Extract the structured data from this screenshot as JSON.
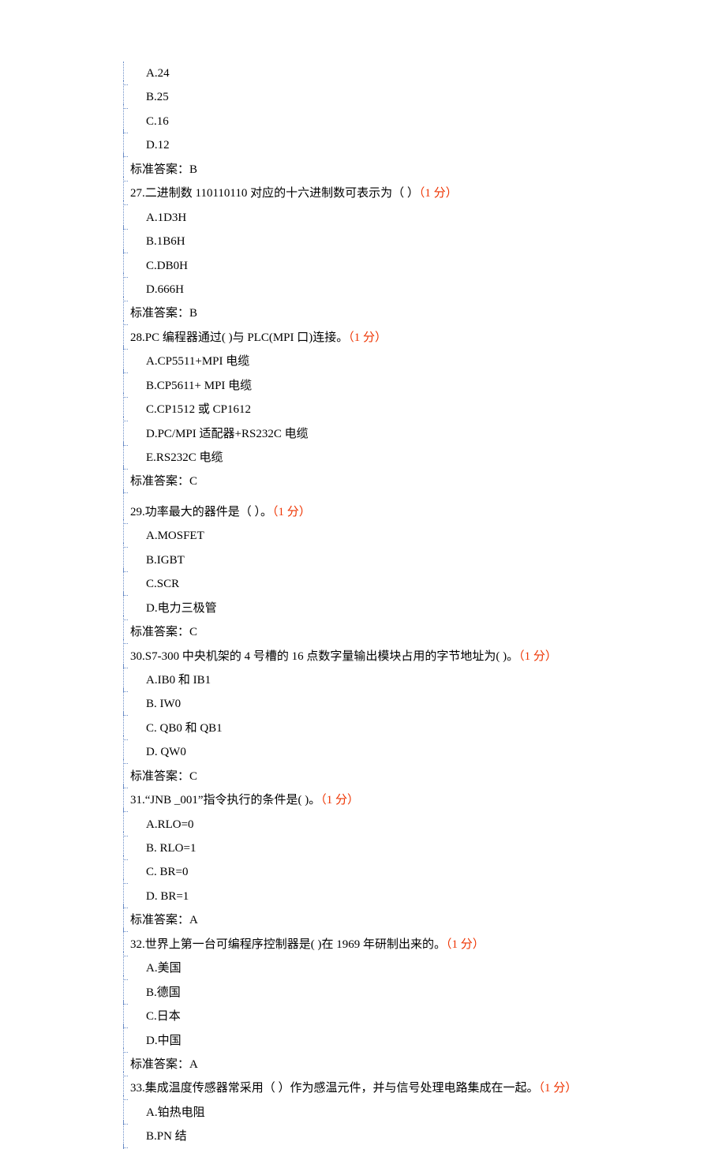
{
  "answer_prefix": "标准答案：",
  "points_label": "（1 分）",
  "orphan_options": [
    {
      "label": "A.24"
    },
    {
      "label": "B.25"
    },
    {
      "label": "C.16"
    },
    {
      "label": "D.12"
    }
  ],
  "orphan_answer": "B",
  "questions": [
    {
      "num": "27",
      "stem": "27.二进制数 110110110 对应的十六进制数可表示为（  ）",
      "options": [
        "A.1D3H",
        "B.1B6H",
        "C.DB0H",
        "D.666H"
      ],
      "answer": "B"
    },
    {
      "num": "28",
      "stem": "28.PC 编程器通过( )与 PLC(MPI 口)连接。",
      "options": [
        "A.CP5511+MPI 电缆",
        "B.CP5611+ MPI 电缆",
        "C.CP1512 或 CP1612",
        "D.PC/MPI 适配器+RS232C 电缆",
        "E.RS232C 电缆"
      ],
      "answer": "C"
    },
    {
      "num": "29",
      "stem": "29.功率最大的器件是（  ）。",
      "options": [
        "A.MOSFET",
        "B.IGBT",
        "C.SCR",
        "D.电力三极管"
      ],
      "answer": "C",
      "gap_before": true
    },
    {
      "num": "30",
      "stem": "30.S7-300 中央机架的 4 号槽的 16 点数字量输出模块占用的字节地址为( )。",
      "options": [
        "A.IB0 和 IB1",
        "B. IW0",
        "C. QB0 和 QB1",
        "D. QW0"
      ],
      "answer": "C"
    },
    {
      "num": "31",
      "stem": "31.“JNB _001”指令执行的条件是( )。",
      "options": [
        "A.RLO=0",
        "B. RLO=1",
        "C. BR=0",
        "D. BR=1"
      ],
      "answer": "A"
    },
    {
      "num": "32",
      "stem": "32.世界上第一台可编程序控制器是( )在 1969 年研制出来的。",
      "options": [
        "A.美国",
        "B.德国",
        "C.日本",
        "D.中国"
      ],
      "answer": "A"
    },
    {
      "num": "33",
      "stem": "33.集成温度传感器常采用（  ）作为感温元件，并与信号处理电路集成在一起。",
      "options": [
        "A.铂热电阻",
        "B.PN  结"
      ],
      "answer": null
    }
  ]
}
